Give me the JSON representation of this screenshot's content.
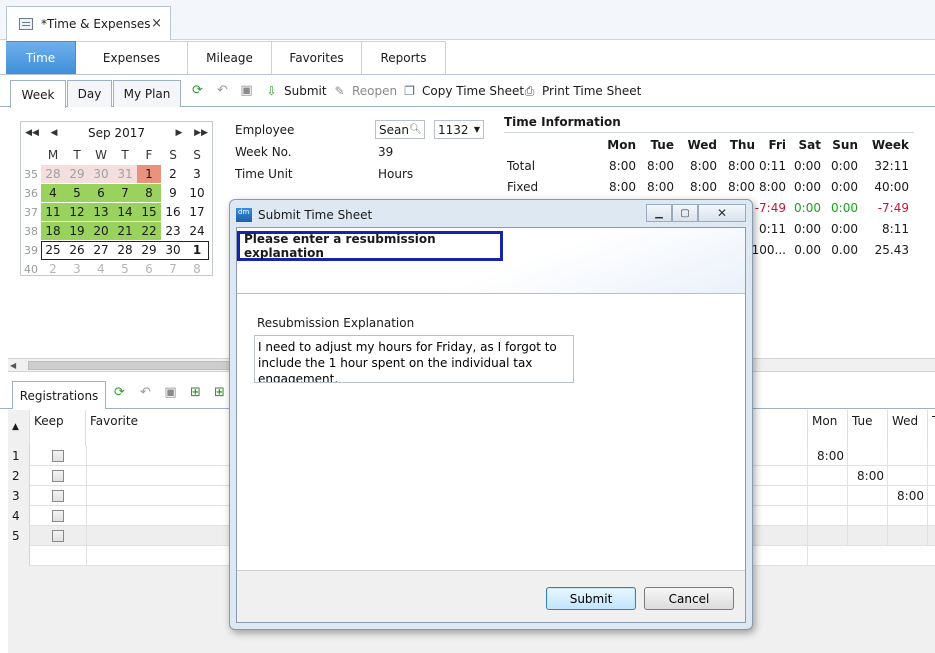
{
  "document_tab": {
    "title": "*Time & Expenses",
    "close": "×"
  },
  "main_tabs": [
    "Time",
    "Expenses",
    "Mileage",
    "Favorites",
    "Reports"
  ],
  "sub_tabs": [
    "Week",
    "Day",
    "My Plan"
  ],
  "toolbar": {
    "submit": "Submit",
    "reopen": "Reopen",
    "copy": "Copy Time Sheet",
    "print": "Print Time Sheet"
  },
  "calendar": {
    "month": "Sep 2017",
    "weekday_headers": [
      "M",
      "T",
      "W",
      "T",
      "F",
      "S",
      "S"
    ],
    "weeks": [
      {
        "wk": "35",
        "days": [
          "28",
          "29",
          "30",
          "31",
          "1",
          "2",
          "3"
        ]
      },
      {
        "wk": "36",
        "days": [
          "4",
          "5",
          "6",
          "7",
          "8",
          "9",
          "10"
        ]
      },
      {
        "wk": "37",
        "days": [
          "11",
          "12",
          "13",
          "14",
          "15",
          "16",
          "17"
        ]
      },
      {
        "wk": "38",
        "days": [
          "18",
          "19",
          "20",
          "21",
          "22",
          "23",
          "24"
        ]
      },
      {
        "wk": "39",
        "days": [
          "25",
          "26",
          "27",
          "28",
          "29",
          "30",
          "1"
        ]
      },
      {
        "wk": "40",
        "days": [
          "2",
          "3",
          "4",
          "5",
          "6",
          "7",
          "8"
        ]
      }
    ]
  },
  "employee": {
    "employee_label": "Employee",
    "employee_name": "Sean",
    "employee_number": "1132",
    "week_label": "Week No.",
    "week_value": "39",
    "unit_label": "Time Unit",
    "unit_value": "Hours"
  },
  "time_info": {
    "title": "Time Information",
    "columns": [
      "Mon",
      "Tue",
      "Wed",
      "Thu",
      "Fri",
      "Sat",
      "Sun",
      "Week"
    ],
    "rows": [
      {
        "label": "Total",
        "values": [
          "8:00",
          "8:00",
          "8:00",
          "8:00",
          "0:11",
          "0:00",
          "0:00",
          "32:11"
        ]
      },
      {
        "label": "Fixed",
        "values": [
          "8:00",
          "8:00",
          "8:00",
          "8:00",
          "8:00",
          "0:00",
          "0:00",
          "40:00"
        ]
      },
      {
        "label": "",
        "values": [
          "",
          "",
          "",
          "",
          "-7:49",
          "0:00",
          "0:00",
          "-7:49"
        ]
      },
      {
        "label": "",
        "values": [
          "",
          "",
          "",
          "",
          "0:11",
          "0:00",
          "0:00",
          "8:11"
        ]
      },
      {
        "label": "",
        "values": [
          "",
          "",
          "",
          "",
          "100...",
          "0.00",
          "0.00",
          "25.43"
        ]
      }
    ],
    "colors": {
      "positive": "#17a317",
      "negative": "#c4143a"
    }
  },
  "registrations": {
    "tab": "Registrations",
    "columns": {
      "keep": "Keep",
      "favorite": "Favorite",
      "mon": "Mon",
      "tue": "Tue",
      "wed": "Wed",
      "thu": "T"
    },
    "rows": [
      {
        "num": "1",
        "mon": "8:00",
        "tue": "",
        "wed": ""
      },
      {
        "num": "2",
        "mon": "",
        "tue": "8:00",
        "wed": ""
      },
      {
        "num": "3",
        "mon": "",
        "tue": "",
        "wed": "8:00"
      },
      {
        "num": "4",
        "mon": "",
        "tue": "",
        "wed": ""
      },
      {
        "num": "5",
        "mon": "",
        "tue": "",
        "wed": ""
      }
    ]
  },
  "dialog": {
    "title": "Submit Time Sheet",
    "header": "Please enter a resubmission explanation",
    "field_label": "Resubmission Explanation",
    "field_value": "I need to adjust my hours for Friday, as I forgot to include the 1 hour spent on the individual tax engagement.",
    "submit": "Submit",
    "cancel": "Cancel"
  },
  "colors": {
    "accent": "#3f8fd9",
    "calendar_registered": "#99d25c",
    "calendar_missing": "#e9937f",
    "highlight_border": "#1524a8"
  }
}
